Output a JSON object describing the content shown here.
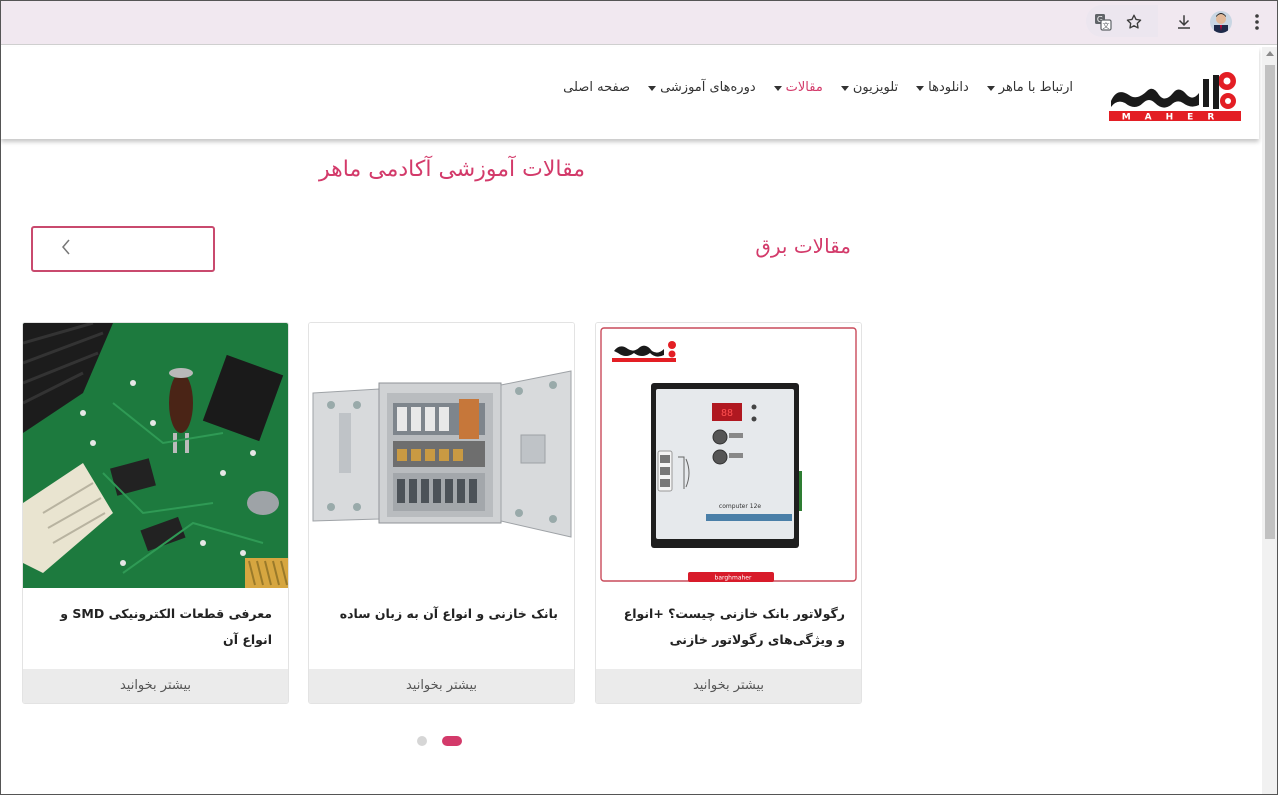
{
  "browser": {
    "icons": [
      "translate-icon",
      "star-icon",
      "download-icon",
      "profile-avatar",
      "menu-dots-icon"
    ]
  },
  "header": {
    "logo_text": "MAHER",
    "nav": [
      {
        "label": "صفحه اصلی",
        "has_caret": false,
        "active": false
      },
      {
        "label": "دوره‌های آموزشی",
        "has_caret": true,
        "active": false
      },
      {
        "label": "مقالات",
        "has_caret": true,
        "active": true
      },
      {
        "label": "تلویزیون",
        "has_caret": true,
        "active": false
      },
      {
        "label": "دانلودها",
        "has_caret": true,
        "active": false
      },
      {
        "label": "ارتباط با ماهر",
        "has_caret": true,
        "active": false
      }
    ]
  },
  "main": {
    "page_title": "مقالات آموزشی آکادمی ماهر",
    "section_title": "مقالات برق",
    "cards": [
      {
        "title": "رگولاتور بانک خازنی چیست؟ +انواع و ویژگی‌های رگولاتور خازنی",
        "more": "بیشتر بخوانید",
        "image": "capacitor-bank-regulator-photo",
        "image_caption": "computer 12e",
        "image_tag": "barghmaher"
      },
      {
        "title": "بانک خازنی و انواع آن به زبان ساده",
        "more": "بیشتر بخوانید",
        "image": "capacitor-bank-cabinet-photo"
      },
      {
        "title": "معرفی قطعات الکترونیکی SMD و انواع آن",
        "more": "بیشتر بخوانید",
        "image": "circuit-board-photo"
      }
    ],
    "pagination": {
      "count": 2,
      "active_index": 1
    }
  },
  "colors": {
    "accent": "#d33a6a",
    "logo_red": "#e31e24",
    "chrome": "#f1e8f0"
  }
}
